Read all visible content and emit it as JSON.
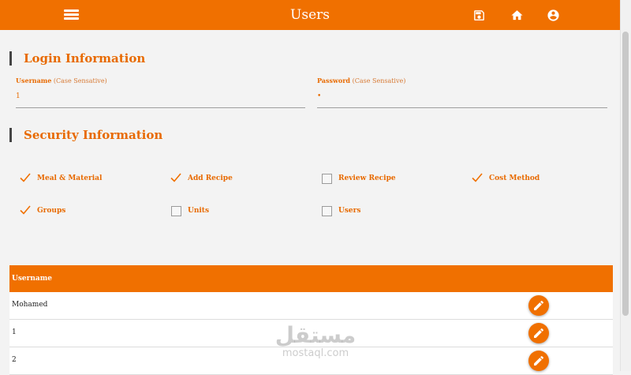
{
  "header": {
    "title": "Users",
    "icons": [
      "menu-icon",
      "save-icon",
      "home-icon",
      "account-icon"
    ],
    "color": "#f07000"
  },
  "login_section": {
    "heading": "Login Information",
    "username": {
      "label": "Username",
      "hint": "(Case Sensative)",
      "value": "1"
    },
    "password": {
      "label": "Password",
      "hint": "(Case Sensative)",
      "value": "•"
    }
  },
  "security_section": {
    "heading": "Security Information",
    "permissions": [
      {
        "label": "Meal & Material",
        "checked": true
      },
      {
        "label": "Add Recipe",
        "checked": true
      },
      {
        "label": "Review Recipe",
        "checked": false
      },
      {
        "label": "Cost Method",
        "checked": true
      },
      {
        "label": "Groups",
        "checked": true
      },
      {
        "label": "Units",
        "checked": false
      },
      {
        "label": "Users",
        "checked": false
      }
    ]
  },
  "users_table": {
    "header": "Username",
    "rows": [
      "Mohamed",
      "1",
      "2"
    ]
  },
  "watermark": {
    "arabic": "مستقل",
    "latin": "mostaql.com"
  }
}
